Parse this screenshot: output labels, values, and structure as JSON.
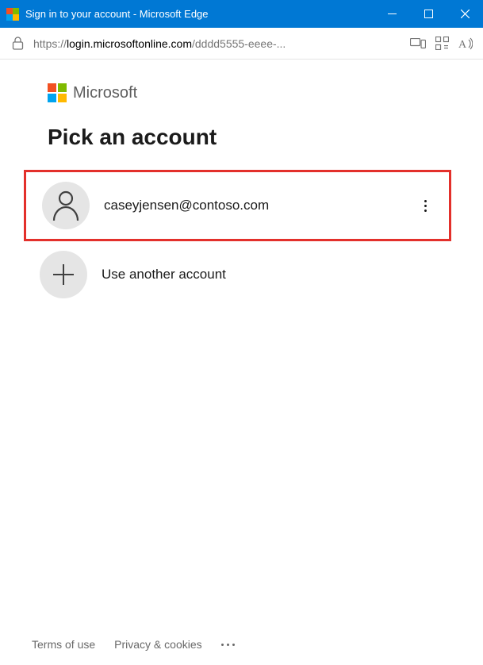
{
  "window": {
    "title": "Sign in to your account - Microsoft Edge"
  },
  "addressbar": {
    "url_prefix": "https://",
    "url_host": "login.microsoftonline.com",
    "url_path": "/dddd5555-eeee-..."
  },
  "branding": {
    "name": "Microsoft"
  },
  "page": {
    "heading": "Pick an account"
  },
  "accounts": [
    {
      "email": "caseyjensen@contoso.com",
      "highlighted": true
    },
    {
      "email": "Use another account",
      "highlighted": false
    }
  ],
  "footer": {
    "terms": "Terms of use",
    "privacy": "Privacy & cookies"
  },
  "colors": {
    "titlebar": "#0078d4",
    "ms_red": "#f25022",
    "ms_green": "#7fba00",
    "ms_blue": "#00a4ef",
    "ms_yellow": "#ffb900",
    "highlight": "#e3302b"
  }
}
